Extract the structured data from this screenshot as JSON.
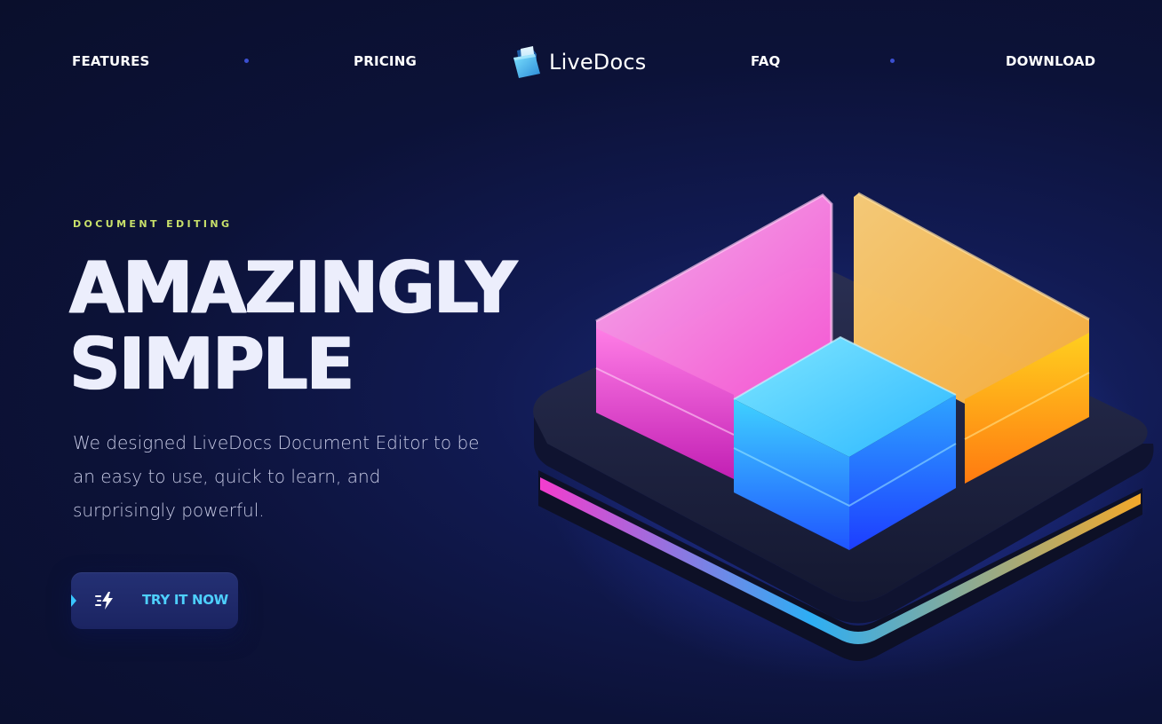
{
  "nav": {
    "links": [
      {
        "label": "FEATURES"
      },
      {
        "label": "PRICING"
      },
      {
        "label": "FAQ"
      },
      {
        "label": "DOWNLOAD"
      }
    ],
    "logo_text": "LiveDocs",
    "logo_icon": "folder-document-icon"
  },
  "hero": {
    "eyebrow": "DOCUMENT EDITING",
    "headline_line1": "AMAZINGLY",
    "headline_line2": "SIMPLE",
    "description": "We designed LiveDocs Document Editor to be an easy to use, quick to learn, and surprisingly powerful.",
    "cta_label": "TRY IT NOW",
    "cta_icon": "lightning-bolt-icon"
  },
  "colors": {
    "background": "#0c1238",
    "accent_cyan": "#4ed0ff",
    "eyebrow": "#c8e06a",
    "block_magenta": "#ff3fd6",
    "block_orange": "#ffa62b",
    "block_blue": "#2f7bff"
  }
}
